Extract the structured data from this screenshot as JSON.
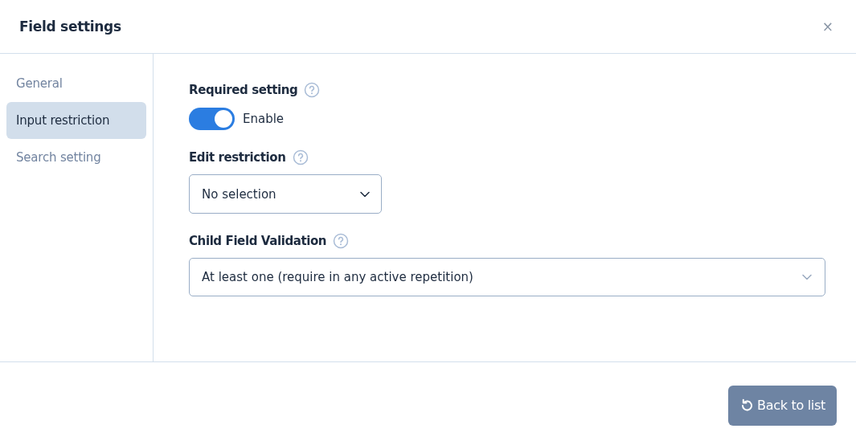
{
  "dialog": {
    "title": "Field settings",
    "close": "×"
  },
  "sidebar": {
    "items": [
      {
        "label": "General",
        "selected": false
      },
      {
        "label": "Input restriction",
        "selected": true
      },
      {
        "label": "Search setting",
        "selected": false
      }
    ]
  },
  "settings": [
    {
      "kind": "toggle",
      "label": "Required setting",
      "on": true,
      "text": "Enable"
    },
    {
      "kind": "select",
      "label": "Edit restriction",
      "value": "No selection",
      "full_width": false
    },
    {
      "kind": "select",
      "label": "Child Field Validation",
      "value": "At least one (require in any active repetition)",
      "full_width": true
    }
  ],
  "footer": {
    "button": "Back to list"
  }
}
